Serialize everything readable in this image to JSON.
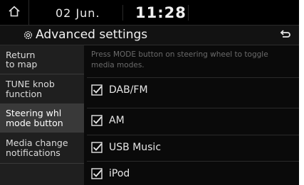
{
  "statusbar": {
    "home_icon": "home-icon",
    "date": "02 Jun.",
    "time": "11:28"
  },
  "header": {
    "title_icon": "gear-icon",
    "title": "Advanced settings",
    "back_icon": "back-arrow-icon"
  },
  "sidebar": {
    "items": [
      {
        "line1": "Return",
        "line2": "to map",
        "active": false
      },
      {
        "line1": "TUNE knob",
        "line2": "function",
        "active": false
      },
      {
        "line1": "Steering whl",
        "line2": "mode button",
        "active": true
      },
      {
        "line1": "Media change",
        "line2": "notifications",
        "active": false
      }
    ]
  },
  "main": {
    "description_line1": "Press MODE button on steering wheel to toggle",
    "description_line2": "media modes.",
    "options": [
      {
        "label": "DAB/FM",
        "checked": true
      },
      {
        "label": "AM",
        "checked": true
      },
      {
        "label": "USB Music",
        "checked": true
      },
      {
        "label": "iPod",
        "checked": true
      }
    ]
  }
}
